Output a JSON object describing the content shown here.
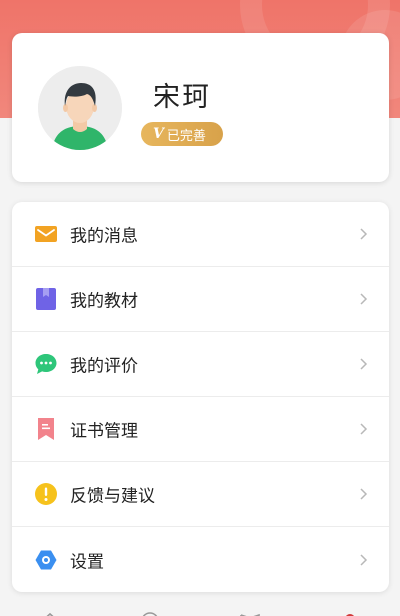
{
  "profile": {
    "name": "宋珂",
    "badge_v": "V",
    "badge_text": "已完善"
  },
  "menu": [
    {
      "label": "我的消息",
      "icon": "envelope-icon",
      "color": "#f2a323"
    },
    {
      "label": "我的教材",
      "icon": "book-icon",
      "color": "#6f63e6"
    },
    {
      "label": "我的评价",
      "icon": "chat-bubble-icon",
      "color": "#2ec67a"
    },
    {
      "label": "证书管理",
      "icon": "bookmark-icon",
      "color": "#f2838c"
    },
    {
      "label": "反馈与建议",
      "icon": "exclamation-icon",
      "color": "#f6c21c"
    },
    {
      "label": "设置",
      "icon": "hexagon-gear-icon",
      "color": "#3b8ff0"
    }
  ],
  "colors": {
    "header": "#ef7469",
    "badge": "#dcaa50",
    "nav_active": "#d13a3a"
  }
}
